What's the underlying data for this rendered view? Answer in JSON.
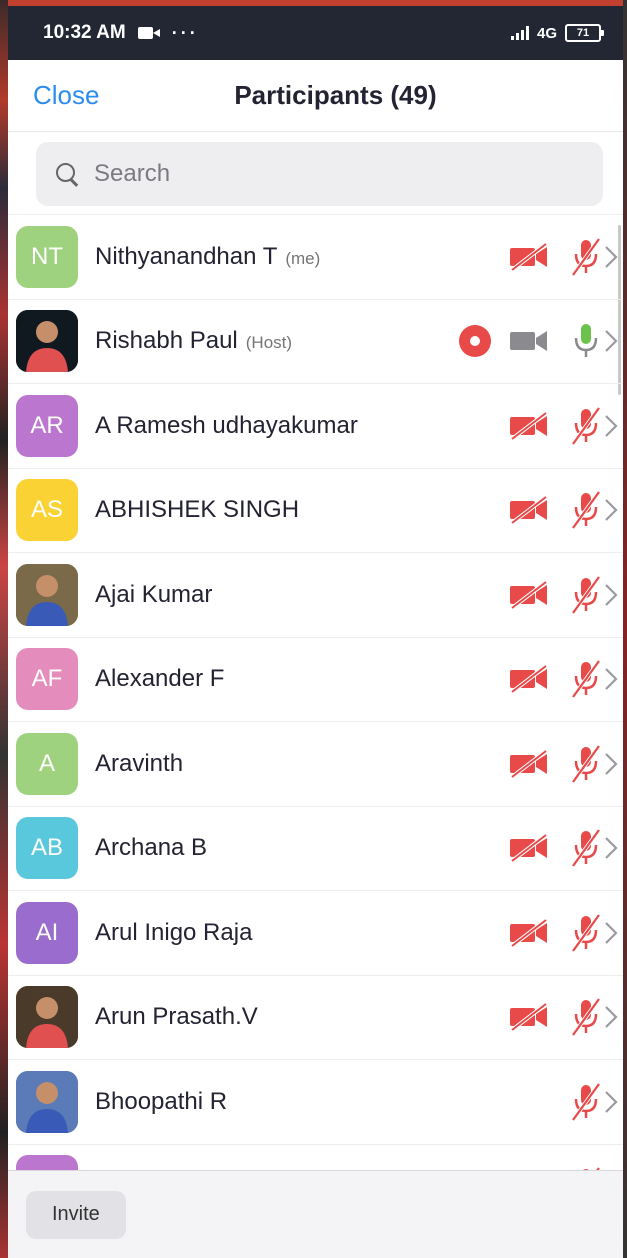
{
  "status_bar": {
    "time": "10:32 AM",
    "dots": "···",
    "network": "4G",
    "battery": "71"
  },
  "header": {
    "close_label": "Close",
    "title": "Participants (49)"
  },
  "search": {
    "placeholder": "Search"
  },
  "colors": {
    "accent": "#2d8cf0",
    "muted_red": "#e84a4a",
    "mic_green": "#6cc24a",
    "video_gray": "#8a8a8f"
  },
  "participants": [
    {
      "initials": "NT",
      "name": "Nithyanandhan T",
      "role": "(me)",
      "avatar_color": "#9fd27e",
      "video": "off",
      "audio": "muted"
    },
    {
      "initials": "",
      "name": "Rishabh Paul",
      "role": "(Host)",
      "avatar_color": "#101820",
      "video": "idle",
      "audio": "on",
      "recording": true
    },
    {
      "initials": "AR",
      "name": "A Ramesh udhayakumar",
      "role": "",
      "avatar_color": "#bb77d0",
      "video": "off",
      "audio": "muted"
    },
    {
      "initials": "AS",
      "name": "ABHISHEK SINGH",
      "role": "",
      "avatar_color": "#fbd233",
      "video": "off",
      "audio": "muted"
    },
    {
      "initials": "",
      "name": "Ajai Kumar",
      "role": "",
      "avatar_color": "#7a6a4a",
      "video": "off",
      "audio": "muted"
    },
    {
      "initials": "AF",
      "name": "Alexander F",
      "role": "",
      "avatar_color": "#e48cbc",
      "video": "off",
      "audio": "muted"
    },
    {
      "initials": "A",
      "name": "Aravinth",
      "role": "",
      "avatar_color": "#9fd27e",
      "video": "off",
      "audio": "muted"
    },
    {
      "initials": "AB",
      "name": "Archana B",
      "role": "",
      "avatar_color": "#5ac8dc",
      "video": "off",
      "audio": "muted"
    },
    {
      "initials": "AI",
      "name": "Arul Inigo Raja",
      "role": "",
      "avatar_color": "#9a6ccd",
      "video": "off",
      "audio": "muted"
    },
    {
      "initials": "",
      "name": "Arun Prasath.V",
      "role": "",
      "avatar_color": "#4a3a2a",
      "video": "off",
      "audio": "muted"
    },
    {
      "initials": "",
      "name": "Bhoopathi R",
      "role": "",
      "avatar_color": "#5a7ab8",
      "video": "none",
      "audio": "muted"
    },
    {
      "initials": "",
      "name": "",
      "role": "",
      "avatar_color": "#bb77d0",
      "video": "off",
      "audio": "muted"
    }
  ],
  "footer": {
    "invite_label": "Invite"
  }
}
